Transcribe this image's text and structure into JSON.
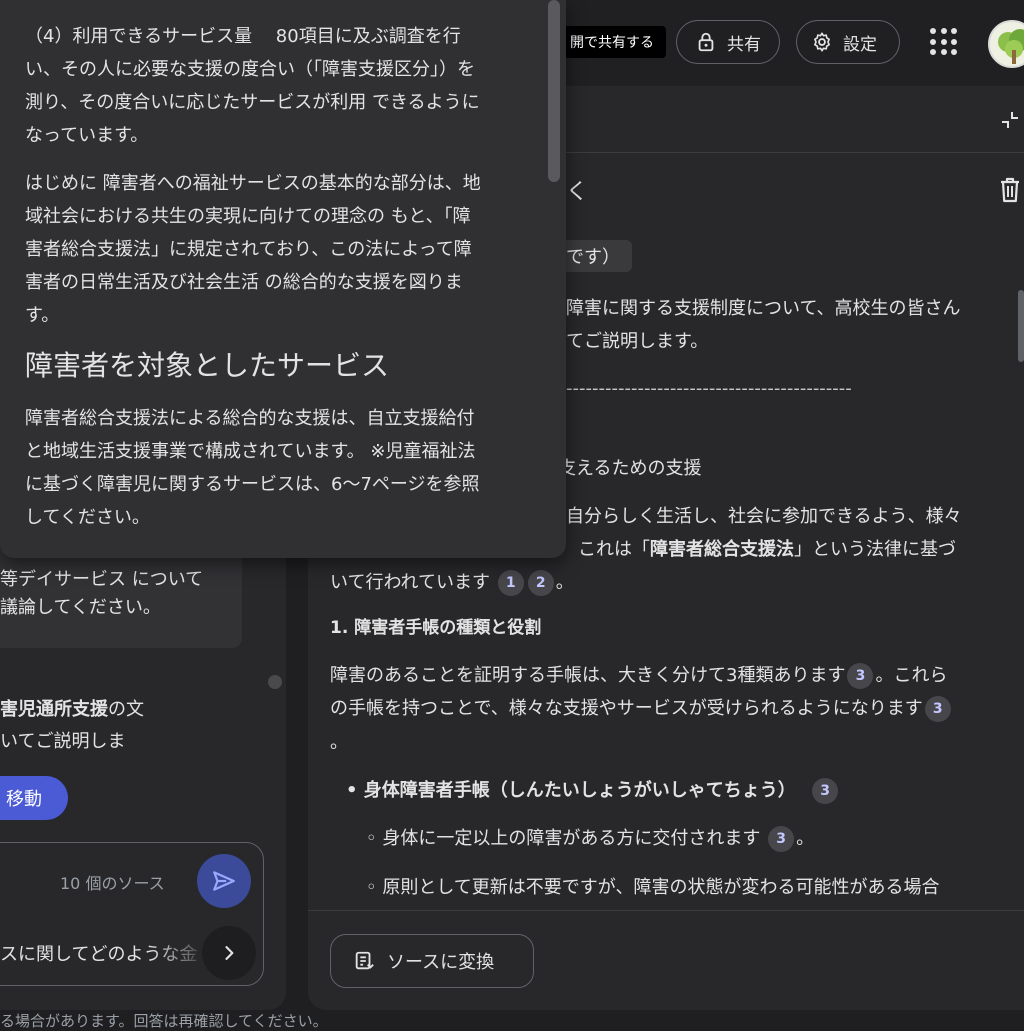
{
  "topbar": {
    "share_public_label": "開で共有する",
    "share_label": "共有",
    "settings_label": "設定"
  },
  "chat": {
    "bubble_lines": [
      "等デイサービス について",
      "議論してください。"
    ],
    "response_lines": [
      "害児通所支援の文",
      "いてご説明しま"
    ],
    "move_button": "移動",
    "source_count": "10 個のソース",
    "suggestion": "スに関してどのような金",
    "footer_note": "る場合があります。回答は再確認してください。"
  },
  "note": {
    "title": "く",
    "chip": "です）",
    "intro_lines": [
      "障害に関する支援制度について、高校生の皆さん",
      "てご説明します。"
    ],
    "dashes": "--------------------------------------------",
    "section_heading": "を支えるための支援",
    "para1_line1": "自分らしく生活し、社会に参加できるよう、様々",
    "para1_line2_pre": "これは「",
    "para1_line2_bold": "障害者総合支援法",
    "para1_line2_post": "」という法律に基づ",
    "para1_line3": "いて行われています",
    "cite_1": "1",
    "cite_2": "2",
    "cite_3": "3",
    "period": "。",
    "sub_heading": "1. 障害者手帳の種類と役割",
    "para2_line1": "障害のあることを証明する手帳は、大きく分けて3種類あります",
    "para2_line1_post": "。これら",
    "para2_line2": "の手帳を持つことで、様々な支援やサービスが受けられるようになります",
    "bullet1": "身体障害者手帳（しんたいしょうがいしゃてちょう）",
    "sub_bullet1": "身体に一定以上の障害がある方に交付されます",
    "sub_bullet2": "原則として更新は不要ですが、障害の状態が変わる可能性がある場合",
    "convert_button": "ソースに変換"
  },
  "source": {
    "p1_lines": [
      "（4）利用できるサービス量　 80項目に及ぶ調査を行",
      "い、その人に必要な支援の度合い（「障害支援区分」）を",
      "測り、その度合いに応じたサービスが利用 できるように",
      "なっています。"
    ],
    "p2_lines": [
      "はじめに 障害者への福祉サービスの基本的な部分は、地",
      "域社会における共生の実現に向けての理念の もと、「障",
      "害者総合支援法」に規定されており、この法によって障",
      "害者の日常生活及び社会生活 の総合的な支援を図りま",
      "す。"
    ],
    "heading": "障害者を対象としたサービス",
    "p3_lines": [
      "障害者総合支援法による総合的な支援は、自立支援給付",
      "と地域生活支援事業で構成されています。 ※児童福祉法",
      "に基づく障害児に関するサービスは、6〜7ページを参照",
      "してください。"
    ]
  }
}
